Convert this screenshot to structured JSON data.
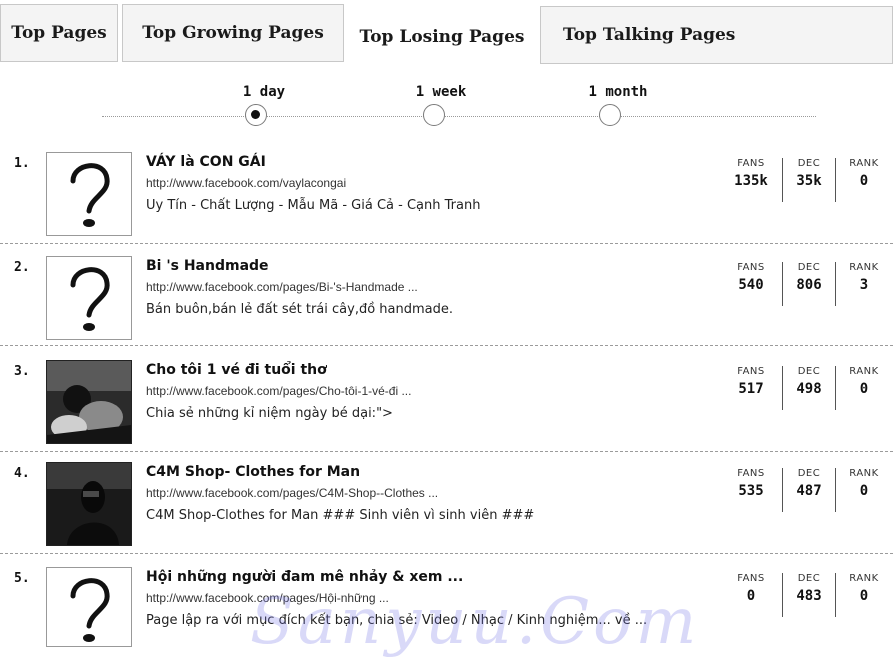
{
  "tabs": [
    {
      "label": "Top Pages"
    },
    {
      "label": "Top Growing Pages"
    },
    {
      "label": "Top Losing Pages",
      "active": true
    },
    {
      "label": "Top Talking Pages"
    }
  ],
  "periods": [
    {
      "label": "1 day",
      "selected": true
    },
    {
      "label": "1 week",
      "selected": false
    },
    {
      "label": "1 month",
      "selected": false
    }
  ],
  "stat_labels": {
    "fans": "FANS",
    "dec": "DEC",
    "rank": "RANK"
  },
  "pages": [
    {
      "num": "1.",
      "title": "VÁY là CON GÁI",
      "url": "http://www.facebook.com/vaylacongai",
      "desc": "Uy Tín - Chất Lượng - Mẫu Mã - Giá Cả - Cạnh Tranh",
      "fans": "135k",
      "dec": "35k",
      "rank": "0",
      "thumb": "question-mark"
    },
    {
      "num": "2.",
      "title": "Bi 's Handmade",
      "url": "http://www.facebook.com/pages/Bi-'s-Handmade ...",
      "desc": "Bán buôn,bán lẻ đất sét trái cây,đồ handmade.",
      "fans": "540",
      "dec": "806",
      "rank": "3",
      "thumb": "question-mark"
    },
    {
      "num": "3.",
      "title": "Cho tôi 1 vé đi tuổi thơ",
      "url": "http://www.facebook.com/pages/Cho-tôi-1-vé-đi ...",
      "desc": "Chia sẻ những kỉ niệm ngày bé dại:\">",
      "fans": "517",
      "dec": "498",
      "rank": "0",
      "thumb": "photo"
    },
    {
      "num": "4.",
      "title": "C4M Shop- Clothes for Man",
      "url": "http://www.facebook.com/pages/C4M-Shop--Clothes ...",
      "desc": "C4M Shop-Clothes for Man ### Sinh viên vì sinh viên ###",
      "fans": "535",
      "dec": "487",
      "rank": "0",
      "thumb": "photo"
    },
    {
      "num": "5.",
      "title": "Hội những người đam mê nhảy & xem ...",
      "url": "http://www.facebook.com/pages/Hội-những ...",
      "desc": "Page lập ra với mục đích kết bạn, chia sẻ: Video / Nhạc / Kinh nghiệm... về ...",
      "fans": "0",
      "dec": "483",
      "rank": "0",
      "thumb": "question-mark"
    }
  ],
  "watermark": "Sanyuu.Com",
  "colors": {
    "separator": "#9b9b9b",
    "tab_border": "#c8c8c8",
    "watermark": "#7878e6"
  }
}
